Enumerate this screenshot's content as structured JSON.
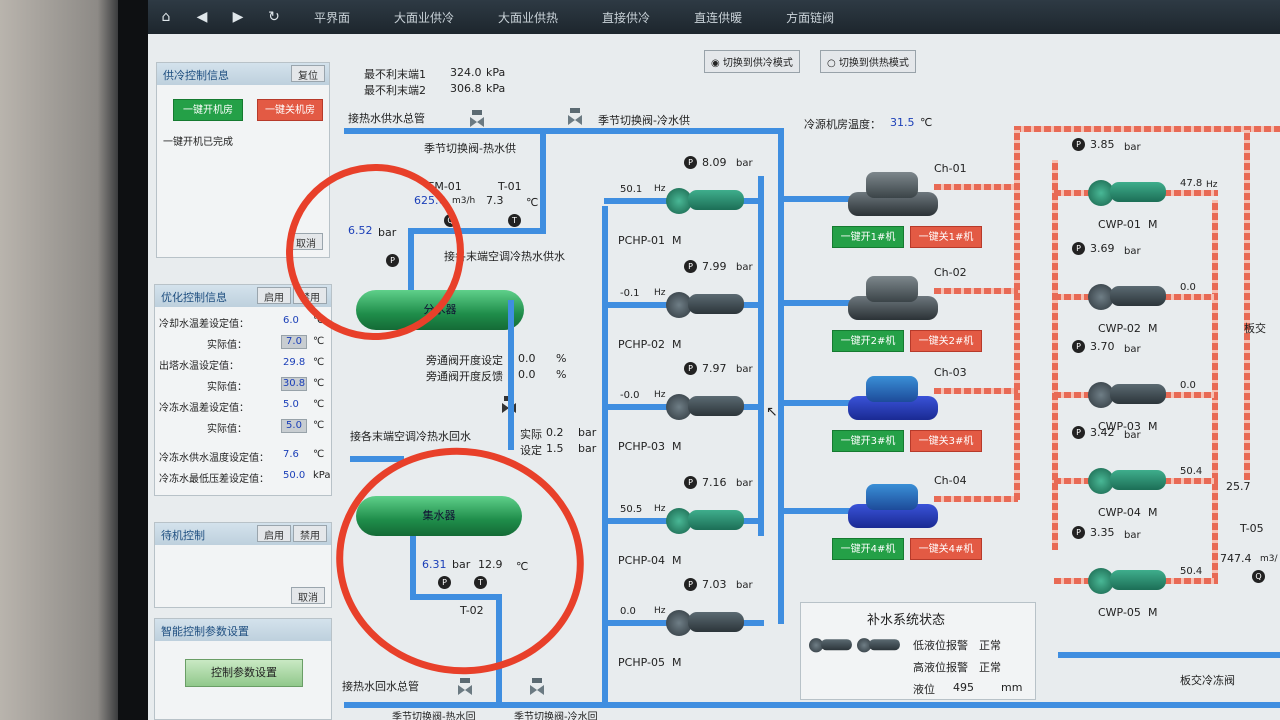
{
  "nav": {
    "tabs": [
      "平界面",
      "大面业供冷",
      "大面业供热",
      "直接供冷",
      "直连供暖",
      "方面链阀"
    ]
  },
  "mode": {
    "cool": "切换到供冷模式",
    "heat": "切换到供热模式"
  },
  "cold_ctrl": {
    "title": "供冷控制信息",
    "reset": "复位",
    "start_all": "一键开机房",
    "stop_all": "一键关机房",
    "status": "一键开机已完成",
    "cancel": "取消"
  },
  "opt_ctrl": {
    "title": "优化控制信息",
    "enable": "启用",
    "disable": "禁用",
    "rows": [
      {
        "label": "冷却水温差设定值：",
        "value": "6.0",
        "unit": "℃"
      },
      {
        "label": "实际值：",
        "value": "7.0",
        "unit": "℃"
      },
      {
        "label": "出塔水温设定值：",
        "value": "29.8",
        "unit": "℃"
      },
      {
        "label": "实际值：",
        "value": "30.8",
        "unit": "℃"
      },
      {
        "label": "冷冻水温差设定值：",
        "value": "5.0",
        "unit": "℃"
      },
      {
        "label": "实际值：",
        "value": "5.0",
        "unit": "℃"
      },
      {
        "label": "冷冻水供水温度设定值：",
        "value": "7.6",
        "unit": "℃"
      },
      {
        "label": "冷冻水最低压差设定值：",
        "value": "50.0",
        "unit": "kPa"
      }
    ]
  },
  "standby": {
    "title": "待机控制",
    "enable": "启用",
    "disable": "禁用",
    "cancel": "取消"
  },
  "smart": {
    "title": "智能控制参数设置",
    "button": "控制参数设置"
  },
  "diagram": {
    "worst1_label": "最不利末端1",
    "worst1_value": "324.0",
    "worst2_label": "最不利末端2",
    "worst2_value": "306.8",
    "kpa": "kPa",
    "supply_main": "接热水供水总管",
    "valve_cold": "季节切换阀-冷水供",
    "valve_hot": "季节切换阀-热水供",
    "room_temp_label": "冷源机房温度：",
    "room_temp": "31.5",
    "deg": "℃",
    "fm_label": "FM-01",
    "fm_value": "625.6",
    "fm_unit": "m3/h",
    "t01_label": "T-01",
    "t01_value": "7.3",
    "p_supply": "6.52",
    "bar": "bar",
    "to_terminal": "接各末端空调冷热水供水",
    "distributor": "分水器",
    "bypass_set_label": "旁通阀开度设定",
    "bypass_set": "0.0",
    "bypass_fb_label": "旁通阀开度反馈",
    "bypass_fb": "0.0",
    "pct": "%",
    "return_terminal": "接各末端空调冷热水回水",
    "actual_label": "实际",
    "actual_value": "0.2",
    "setpoint_label": "设定",
    "setpoint_value": "1.5",
    "collector": "集水器",
    "p_return": "6.31",
    "t02_value": "12.9",
    "t02_label": "T-02",
    "return_main": "接热水回水总管",
    "valve_hot_return": "季节切换阀-热水回",
    "valve_cold_return": "季节切换阀-冷水回",
    "hz": "Hz",
    "m": "M",
    "pumps": [
      {
        "name": "PCHP-01",
        "hz": "50.1",
        "p": "8.09"
      },
      {
        "name": "PCHP-02",
        "hz": "-0.1",
        "p": "7.99"
      },
      {
        "name": "PCHP-03",
        "hz": "-0.0",
        "p": "7.97"
      },
      {
        "name": "PCHP-04",
        "hz": "50.5",
        "p": "7.16"
      },
      {
        "name": "PCHP-05",
        "hz": "0.0",
        "p": "7.03"
      }
    ],
    "chillers": [
      {
        "name": "Ch-01",
        "on": "一键开1#机",
        "off": "一键关1#机"
      },
      {
        "name": "Ch-02",
        "on": "一键开2#机",
        "off": "一键关2#机"
      },
      {
        "name": "Ch-03",
        "on": "一键开3#机",
        "off": "一键关3#机"
      },
      {
        "name": "Ch-04",
        "on": "一键开4#机",
        "off": "一键关4#机"
      }
    ],
    "cwps": [
      {
        "name": "CWP-01",
        "hz": "47.8",
        "p": "3.85"
      },
      {
        "name": "CWP-02",
        "hz": "0.0",
        "p": "3.69"
      },
      {
        "name": "CWP-03",
        "hz": "0.0",
        "p": "3.70"
      },
      {
        "name": "CWP-04",
        "hz": "50.4",
        "p": "3.42"
      },
      {
        "name": "CWP-05",
        "hz": "50.4",
        "p": "3.35"
      }
    ],
    "right_temp": "25.7",
    "right_t05": "T-05",
    "right_flow": "747.4",
    "right_flow_unit": "m3/",
    "right_board": "板交",
    "makeup_title": "补水系统状态",
    "low_alarm_label": "低液位报警",
    "low_alarm": "正常",
    "high_alarm_label": "高液位报警",
    "high_alarm": "正常",
    "level_label": "液位",
    "level_value": "495",
    "level_unit": "mm",
    "plate_valve": "板交冷冻阀",
    "gauge_p": "P"
  }
}
